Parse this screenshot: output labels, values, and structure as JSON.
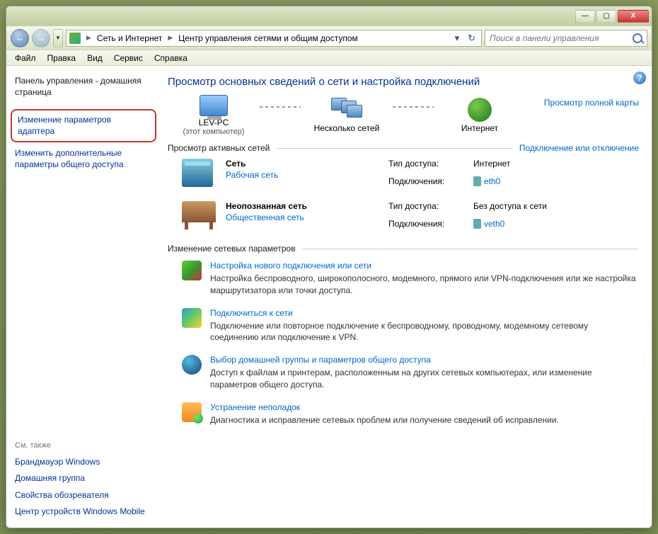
{
  "titlebar": {
    "minimize": "—",
    "maximize": "▢",
    "close": "X"
  },
  "nav": {
    "back": "←",
    "forward": "→",
    "dropdown": "▼",
    "refresh": "↻"
  },
  "breadcrumb": {
    "seg1": "Сеть и Интернет",
    "seg2": "Центр управления сетями и общим доступом"
  },
  "search": {
    "placeholder": "Поиск в панели управления"
  },
  "menubar": {
    "file": "Файл",
    "edit": "Правка",
    "view": "Вид",
    "tools": "Сервис",
    "help": "Справка"
  },
  "sidebar": {
    "home": "Панель управления - домашняя страница",
    "adapter": "Изменение параметров адаптера",
    "sharing": "Изменить дополнительные параметры общего доступа",
    "see_also": "См. также",
    "firewall": "Брандмауэр Windows",
    "homegroup": "Домашняя группа",
    "browser": "Свойства обозревателя",
    "mobile": "Центр устройств Windows Mobile"
  },
  "content": {
    "title": "Просмотр основных сведений о сети и настройка подключений",
    "map_link": "Просмотр полной карты",
    "node_pc": "LEV-PC",
    "node_pc_sub": "(этот компьютер)",
    "node_multi": "Несколько сетей",
    "node_internet": "Интернет",
    "active_header": "Просмотр активных сетей",
    "connect_link": "Подключение или отключение",
    "net1": {
      "name": "Сеть",
      "type": "Рабочая сеть",
      "access_k": "Тип доступа:",
      "access_v": "Интернет",
      "conn_k": "Подключения:",
      "conn_v": "eth0"
    },
    "net2": {
      "name": "Неопознанная сеть",
      "type": "Общественная сеть",
      "access_k": "Тип доступа:",
      "access_v": "Без доступа к сети",
      "conn_k": "Подключения:",
      "conn_v": "veth0"
    },
    "change_header": "Изменение сетевых параметров",
    "task1": {
      "title": "Настройка нового подключения или сети",
      "desc": "Настройка беспроводного, широкополосного, модемного, прямого или VPN-подключения или же настройка маршрутизатора или точки доступа."
    },
    "task2": {
      "title": "Подключиться к сети",
      "desc": "Подключение или повторное подключение к беспроводному, проводному, модемному сетевому соединению или подключение к VPN."
    },
    "task3": {
      "title": "Выбор домашней группы и параметров общего доступа",
      "desc": "Доступ к файлам и принтерам, расположенным на других сетевых компьютерах, или изменение параметров общего доступа."
    },
    "task4": {
      "title": "Устранение неполадок",
      "desc": "Диагностика и исправление сетевых проблем или получение сведений об исправлении."
    }
  }
}
